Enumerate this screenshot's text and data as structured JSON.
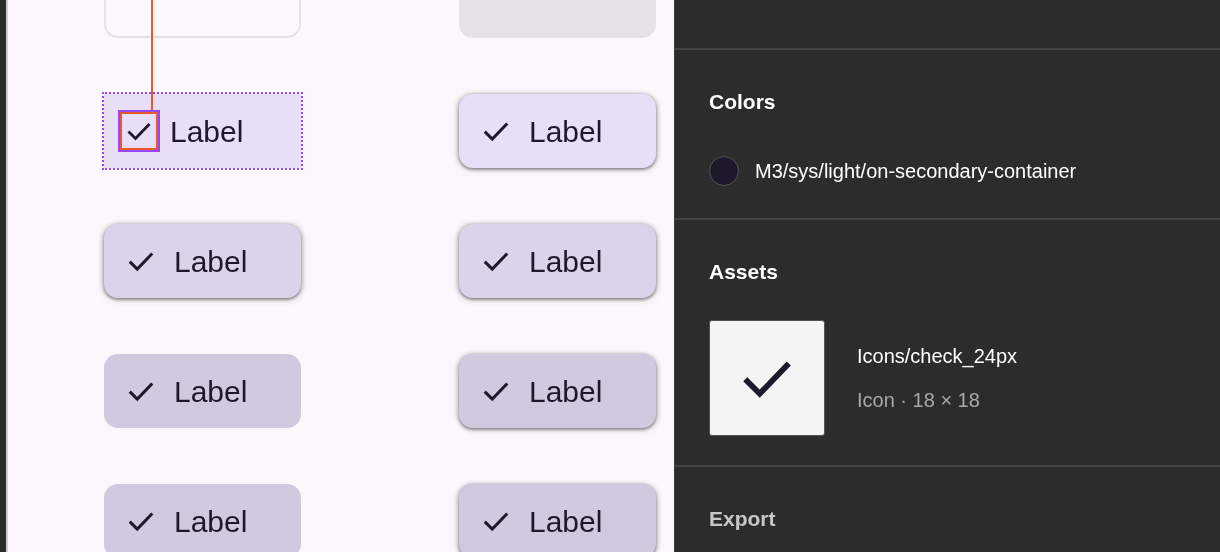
{
  "canvas": {
    "chips": [
      {
        "kind": "disabled-outlined",
        "elevated": false,
        "selected": false
      },
      {
        "kind": "disabled-filled",
        "elevated": false,
        "selected": false
      },
      {
        "label": "Label",
        "kind": "light",
        "elevated": false,
        "selected": true,
        "check": true
      },
      {
        "label": "Label",
        "kind": "light",
        "elevated": true,
        "selected": false,
        "check": true
      },
      {
        "label": "Label",
        "kind": "medium",
        "elevated": true,
        "selected": false,
        "check": true
      },
      {
        "label": "Label",
        "kind": "medium",
        "elevated": true,
        "selected": false,
        "check": true
      },
      {
        "label": "Label",
        "kind": "dark",
        "elevated": false,
        "selected": false,
        "check": true
      },
      {
        "label": "Label",
        "kind": "dark",
        "elevated": true,
        "selected": false,
        "check": true
      },
      {
        "label": "Label",
        "kind": "dark",
        "elevated": false,
        "selected": false,
        "check": true
      },
      {
        "label": "Label",
        "kind": "dark",
        "elevated": true,
        "selected": false,
        "check": true
      }
    ]
  },
  "inspector": {
    "colors": {
      "title": "Colors",
      "items": [
        {
          "name": "M3/sys/light/on-secondary-container",
          "color": "#1d192b"
        }
      ]
    },
    "assets": {
      "title": "Assets",
      "items": [
        {
          "name": "Icons/check_24px",
          "detail": "Icon · 18 × 18"
        }
      ]
    },
    "export": {
      "title": "Export"
    }
  }
}
